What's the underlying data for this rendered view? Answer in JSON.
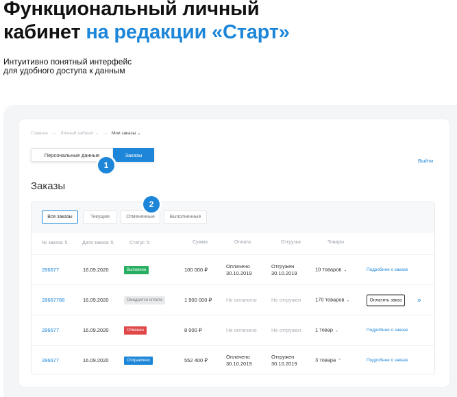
{
  "hero": {
    "title_line1": "Функциональный личный",
    "title_line2_plain": "кабинет",
    "title_line2_accent": "на редакции «Старт»",
    "subtitle_line1": "Интуитивно понятный интерфейс",
    "subtitle_line2": "для удобного доступа к данным"
  },
  "breadcrumbs": [
    "Главная",
    "Личный кабинет",
    "Мои заказы"
  ],
  "tabs": {
    "personal": "Персональные данные",
    "orders": "Заказы"
  },
  "badges": {
    "one": "1",
    "two": "2"
  },
  "logout": "Выйти",
  "section_title": "Заказы",
  "filters": [
    "Все заказы",
    "Текущие",
    "Отмененные",
    "Выполненные"
  ],
  "columns": [
    "№ заказа",
    "Дата заказа",
    "Статус",
    "Сумма",
    "Оплата",
    "Отгрузка",
    "Товары"
  ],
  "sort_icon": "⇅",
  "details_link": "Подробнее о заказе",
  "pay_button": "Оплатить заказ",
  "colors": {
    "accent": "#1d86d8",
    "done": "#27ae60",
    "waiting": "#e9eaec",
    "cancelled": "#e04848",
    "shipped": "#1d86d8"
  },
  "orders": [
    {
      "id": "286677",
      "date": "16.09.2020",
      "status": "Выполнен",
      "sum": "100 000 ₽",
      "pay1": "Оплачено",
      "pay2": "30.10.2019",
      "ship1": "Отгружен",
      "ship2": "30.10.2019",
      "goods": "10 товаров",
      "chevron": "⌄"
    },
    {
      "id": "28667788",
      "date": "16.09.2020",
      "status": "Ожидается оплата",
      "sum": "1 900 000 ₽",
      "pay": "Не оплачено",
      "ship": "Не отгружен",
      "goods": "170 товаров",
      "chevron": "⌄",
      "expand": "»"
    },
    {
      "id": "286677",
      "date": "16.09.2020",
      "status": "Отменен",
      "sum": "8 000 ₽",
      "pay": "Не оплачено",
      "ship": "Не отгружен",
      "goods": "1 товар",
      "chevron": "⌄"
    },
    {
      "id": "286677",
      "date": "16.09.2020",
      "status": "Отправлено",
      "sum": "552 400 ₽",
      "pay1": "Оплачено",
      "pay2": "30.10.2019",
      "ship1": "Отгружен",
      "ship2": "30.10.2019",
      "goods": "3 товара",
      "chevron": "⌃"
    }
  ]
}
